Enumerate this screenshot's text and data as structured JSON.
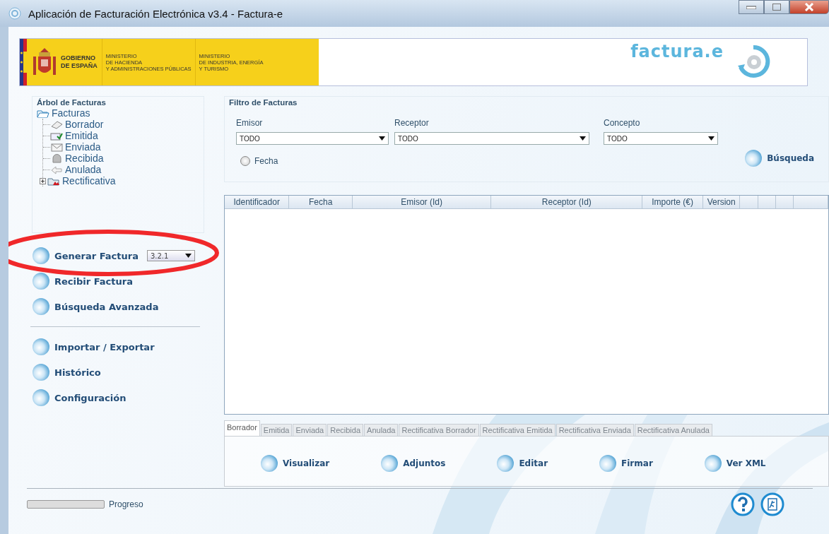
{
  "window": {
    "title": "Aplicación de Facturación Electrónica v3.4 - Factura-e"
  },
  "banner": {
    "government": [
      "GOBIERNO",
      "DE ESPAÑA"
    ],
    "ministries": [
      {
        "lines": [
          "MINISTERIO",
          "DE HACIENDA",
          "Y ADMINISTRACIONES PÚBLICAS"
        ]
      },
      {
        "lines": [
          "MINISTERIO",
          "DE INDUSTRIA, ENERGÍA",
          "Y TURISMO"
        ]
      }
    ],
    "logo_text": "factura.e"
  },
  "tree": {
    "title": "Árbol de Facturas",
    "root": {
      "label": "Facturas",
      "expanded": true,
      "children": [
        {
          "label": "Borrador",
          "kind": "draft"
        },
        {
          "label": "Emitida",
          "kind": "issued"
        },
        {
          "label": "Enviada",
          "kind": "sent"
        },
        {
          "label": "Recibida",
          "kind": "received"
        },
        {
          "label": "Anulada",
          "kind": "cancelled"
        },
        {
          "label": "Rectificativa",
          "kind": "corrective",
          "expanded": false
        }
      ]
    }
  },
  "nav": {
    "groups": [
      [
        {
          "label": "Generar Factura",
          "version": "3.2.1"
        },
        {
          "label": "Recibir Factura"
        },
        {
          "label": "Búsqueda Avanzada"
        }
      ],
      [
        {
          "label": "Importar / Exportar"
        },
        {
          "label": "Histórico"
        },
        {
          "label": "Configuración"
        }
      ]
    ]
  },
  "filter": {
    "title": "Filtro de Facturas",
    "fields": [
      {
        "label": "Emisor",
        "value": "TODO"
      },
      {
        "label": "Receptor",
        "value": "TODO"
      },
      {
        "label": "Concepto",
        "value": "TODO"
      }
    ],
    "date": {
      "label": "Fecha",
      "checked": false
    },
    "search_button": "Búsqueda"
  },
  "table": {
    "columns": [
      "Identificador",
      "Fecha",
      "Emisor (Id)",
      "Receptor (Id)",
      "Importe (€)",
      "Version"
    ]
  },
  "tabs": [
    {
      "label": "Borrador",
      "selected": true,
      "disabled": false
    },
    {
      "label": "Emitida",
      "selected": false,
      "disabled": true
    },
    {
      "label": "Enviada",
      "selected": false,
      "disabled": true
    },
    {
      "label": "Recibida",
      "selected": false,
      "disabled": true
    },
    {
      "label": "Anulada",
      "selected": false,
      "disabled": true
    },
    {
      "label": "Rectificativa Borrador",
      "selected": false,
      "disabled": true
    },
    {
      "label": "Rectificativa Emitida",
      "selected": false,
      "disabled": true
    },
    {
      "label": "Rectificativa Enviada",
      "selected": false,
      "disabled": true
    },
    {
      "label": "Rectificativa Anulada",
      "selected": false,
      "disabled": true
    }
  ],
  "actions": [
    "Visualizar",
    "Adjuntos",
    "Editar",
    "Firmar",
    "Ver XML"
  ],
  "progress": {
    "label": "Progreso",
    "level": 0
  }
}
